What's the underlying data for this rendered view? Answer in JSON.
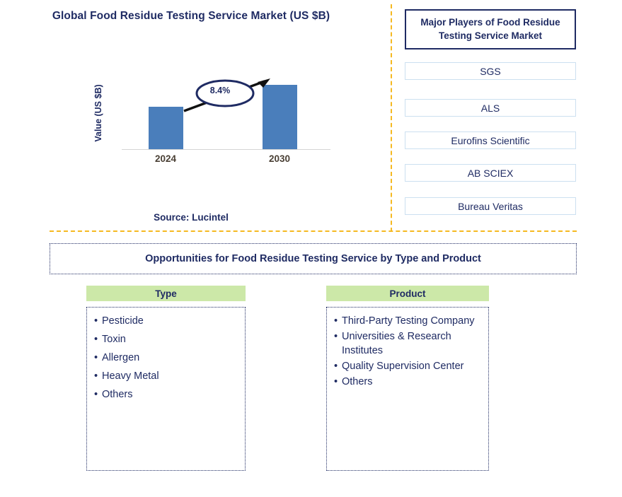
{
  "chart_panel": {
    "title": "Global Food Residue Testing Service Market (US $B)",
    "source": "Source: Lucintel"
  },
  "chart_data": {
    "type": "bar",
    "title": "Global Food Residue Testing Service Market (US $B)",
    "categories": [
      "2024",
      "2030"
    ],
    "values": [
      60,
      91
    ],
    "xlabel": "",
    "ylabel": "Value (US $B)",
    "annotations": [
      {
        "label": "8.4%",
        "type": "cagr-callout",
        "from": "2024",
        "to": "2030"
      }
    ],
    "grid": false,
    "legend": "none",
    "series_color": "#4A7EBB",
    "axis_tick_labels": [
      "2024",
      "2030"
    ]
  },
  "players_panel": {
    "header": "Major Players of Food Residue Testing Service Market",
    "items": [
      {
        "name": "SGS"
      },
      {
        "name": "ALS"
      },
      {
        "name": "Eurofins Scientific"
      },
      {
        "name": "AB SCIEX"
      },
      {
        "name": "Bureau Veritas"
      }
    ]
  },
  "opportunities": {
    "banner": "Opportunities for Food Residue Testing Service by Type and Product",
    "columns": [
      {
        "header": "Type",
        "items": [
          "Pesticide",
          "Toxin",
          "Allergen",
          "Heavy Metal",
          "Others"
        ]
      },
      {
        "header": "Product",
        "items": [
          "Third-Party Testing Company",
          "Universities & Research Institutes",
          "Quality Supervision Center",
          "Others"
        ]
      }
    ]
  },
  "colors": {
    "navy": "#1F2B63",
    "bar_blue": "#4A7EBB",
    "divider_amber": "#F5B921",
    "header_green": "#CCE8A8",
    "box_border_blue": "#CCE0F0",
    "year_label": "#4A4035"
  }
}
